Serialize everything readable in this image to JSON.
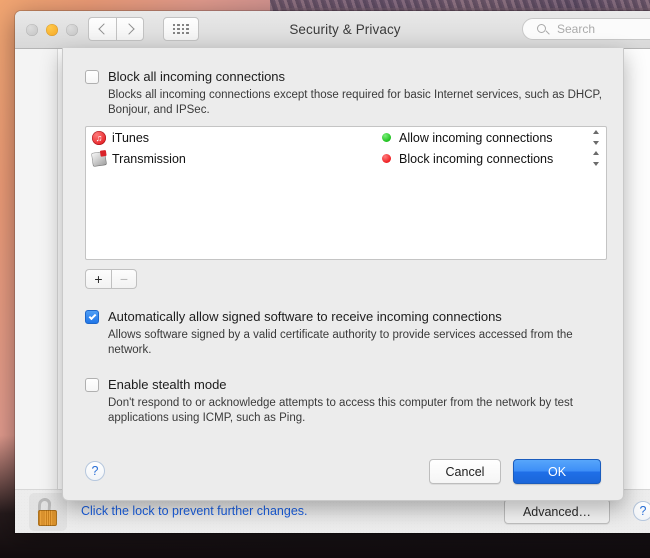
{
  "window": {
    "title": "Security & Privacy",
    "traffic_lights": [
      {
        "name": "close",
        "color": "#c3c3c3"
      },
      {
        "name": "minimize",
        "color": "#f5a623"
      },
      {
        "name": "zoom",
        "color": "#c3c3c3"
      }
    ],
    "nav": {
      "back_icon": "chevron-left-icon",
      "forward_icon": "chevron-right-icon",
      "grid_icon": "show-all-grid-icon"
    },
    "search": {
      "placeholder": "Search",
      "value": "",
      "icon": "search-icon"
    }
  },
  "sheet": {
    "block_all": {
      "label": "Block all incoming connections",
      "checked": false,
      "description": "Blocks all incoming connections except those required for basic Internet services,  such as DHCP, Bonjour, and IPSec."
    },
    "app_list": [
      {
        "icon": "itunes-app-icon",
        "name": "iTunes",
        "status": "Allow incoming connections",
        "status_color": "#1fc11f",
        "status_state": "allow"
      },
      {
        "icon": "transmission-app-icon",
        "name": "Transmission",
        "status": "Block incoming connections",
        "status_color": "#ef1f23",
        "status_state": "block"
      }
    ],
    "add_button": {
      "label": "+",
      "name": "add-application-button",
      "enabled": true
    },
    "remove_button": {
      "label": "−",
      "name": "remove-application-button",
      "enabled": false
    },
    "auto_allow": {
      "label": "Automatically allow signed software to receive incoming connections",
      "checked": true,
      "description": "Allows software signed by a valid certificate authority to provide services accessed from the network."
    },
    "stealth_mode": {
      "label": "Enable stealth mode",
      "checked": false,
      "description": "Don't respond to or acknowledge attempts to access this computer from the network by test applications using ICMP, such as Ping."
    },
    "help_label": "?",
    "cancel_label": "Cancel",
    "ok_label": "OK"
  },
  "bottom_bar": {
    "lock_icon": "unlocked-padlock-icon",
    "lock_message": "Click the lock to prevent further changes.",
    "advanced_label": "Advanced…",
    "help_label": "?"
  },
  "colors": {
    "accent_blue": "#1f6fe8",
    "link_blue": "#1a5fe0",
    "allow_green": "#1fc11f",
    "block_red": "#ef1f23",
    "lock_gold": "#e9a23c",
    "sheet_bg": "#ececec"
  }
}
